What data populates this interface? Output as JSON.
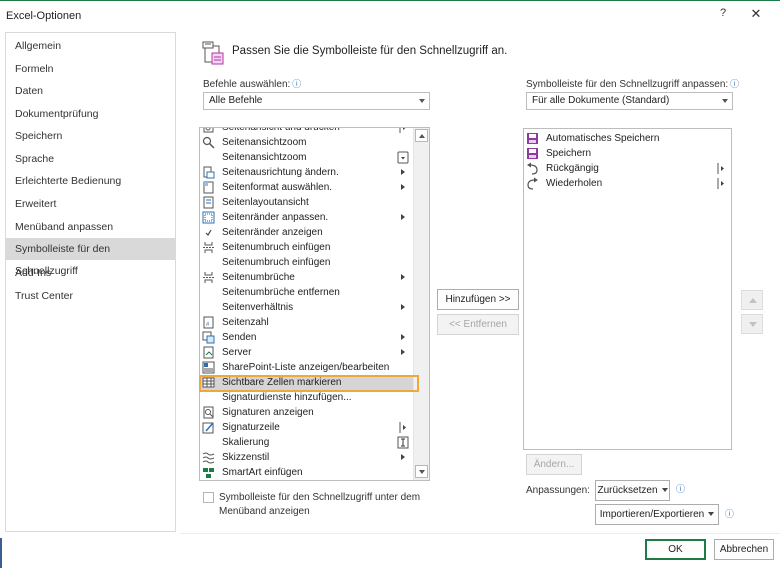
{
  "window": {
    "title": "Excel-Optionen",
    "help_label": "?",
    "close_label": "✕"
  },
  "nav": {
    "items": [
      {
        "label": "Allgemein"
      },
      {
        "label": "Formeln"
      },
      {
        "label": "Daten"
      },
      {
        "label": "Dokumentprüfung"
      },
      {
        "label": "Speichern"
      },
      {
        "label": "Sprache"
      },
      {
        "label": "Erleichterte Bedienung"
      },
      {
        "label": "Erweitert"
      },
      {
        "label": "Menüband anpassen"
      },
      {
        "label": "Symbolleiste für den Schnellzugriff",
        "selected": true
      },
      {
        "label": "Add-Ins"
      },
      {
        "label": "Trust Center"
      }
    ]
  },
  "main": {
    "heading": "Passen Sie die Symbolleiste für den Schnellzugriff an.",
    "commands_label": "Befehle auswählen:",
    "commands_value": "Alle Befehle",
    "toolbar_label": "Symbolleiste für den Schnellzugriff anpassen:",
    "toolbar_value": "Für alle Dokumente (Standard)",
    "info_icon": "ⓘ"
  },
  "commands": [
    {
      "label": "Seitenansicht und drucken",
      "icon": "print-preview-icon",
      "side": "submenu-bar"
    },
    {
      "label": "Seitenansichtzoom",
      "icon": "magnifier-icon"
    },
    {
      "label": "Seitenansichtzoom",
      "icon": "",
      "side": "combo"
    },
    {
      "label": "Seitenausrichtung ändern.",
      "icon": "page-orientation-icon",
      "sub": true
    },
    {
      "label": "Seitenformat auswählen.",
      "icon": "page-size-icon",
      "sub": true
    },
    {
      "label": "Seitenlayoutansicht",
      "icon": "page-layout-icon"
    },
    {
      "label": "Seitenränder anpassen.",
      "icon": "margins-icon",
      "sub": true
    },
    {
      "label": "Seitenränder anzeigen",
      "icon": "checkmark-icon"
    },
    {
      "label": "Seitenumbruch einfügen",
      "icon": "page-break-icon"
    },
    {
      "label": "Seitenumbruch einfügen",
      "icon": ""
    },
    {
      "label": "Seitenumbrüche",
      "icon": "page-break-icon",
      "sub": true
    },
    {
      "label": "Seitenumbrüche entfernen",
      "icon": ""
    },
    {
      "label": "Seitenverhältnis",
      "icon": "",
      "sub": true
    },
    {
      "label": "Seitenzahl",
      "icon": "page-number-icon"
    },
    {
      "label": "Senden",
      "icon": "send-icon",
      "sub": true
    },
    {
      "label": "Server",
      "icon": "server-icon",
      "sub": true
    },
    {
      "label": "SharePoint-Liste anzeigen/bearbeiten",
      "icon": "sharepoint-list-icon"
    },
    {
      "label": "Sichtbare Zellen markieren",
      "icon": "visible-cells-icon",
      "highlighted": true
    },
    {
      "label": "Signaturdienste hinzufügen...",
      "icon": ""
    },
    {
      "label": "Signaturen anzeigen",
      "icon": "signatures-icon"
    },
    {
      "label": "Signaturzeile",
      "icon": "signature-line-icon",
      "side": "submenu-bar"
    },
    {
      "label": "Skalierung",
      "icon": "",
      "side": "text-cursor"
    },
    {
      "label": "Skizzenstil",
      "icon": "sketch-style-icon",
      "sub": true
    },
    {
      "label": "SmartArt einfügen",
      "icon": "smartart-icon"
    }
  ],
  "toolbar_items": [
    {
      "label": "Automatisches Speichern",
      "icon": "autosave-icon"
    },
    {
      "label": "Speichern",
      "icon": "save-icon"
    },
    {
      "label": "Rückgängig",
      "icon": "undo-icon",
      "side": "submenu-bar"
    },
    {
      "label": "Wiederholen",
      "icon": "redo-icon",
      "side": "submenu-bar"
    }
  ],
  "buttons": {
    "add": "Hinzufügen >>",
    "remove": "<< Entfernen",
    "modify": "Ändern...",
    "customizations_label": "Anpassungen:",
    "reset": "Zurücksetzen",
    "import_export": "Importieren/Exportieren",
    "ok": "OK",
    "cancel": "Abbrechen"
  },
  "checkbox": {
    "label": "Symbolleiste für den Schnellzugriff unter dem Menüband anzeigen",
    "checked": false
  },
  "colors": {
    "accent_green": "#1e7b45",
    "highlight_orange": "#f0a73c",
    "selected_gray": "#d9d9d9",
    "info_blue": "#2b6fb5",
    "save_purple": "#8e3a9e"
  }
}
